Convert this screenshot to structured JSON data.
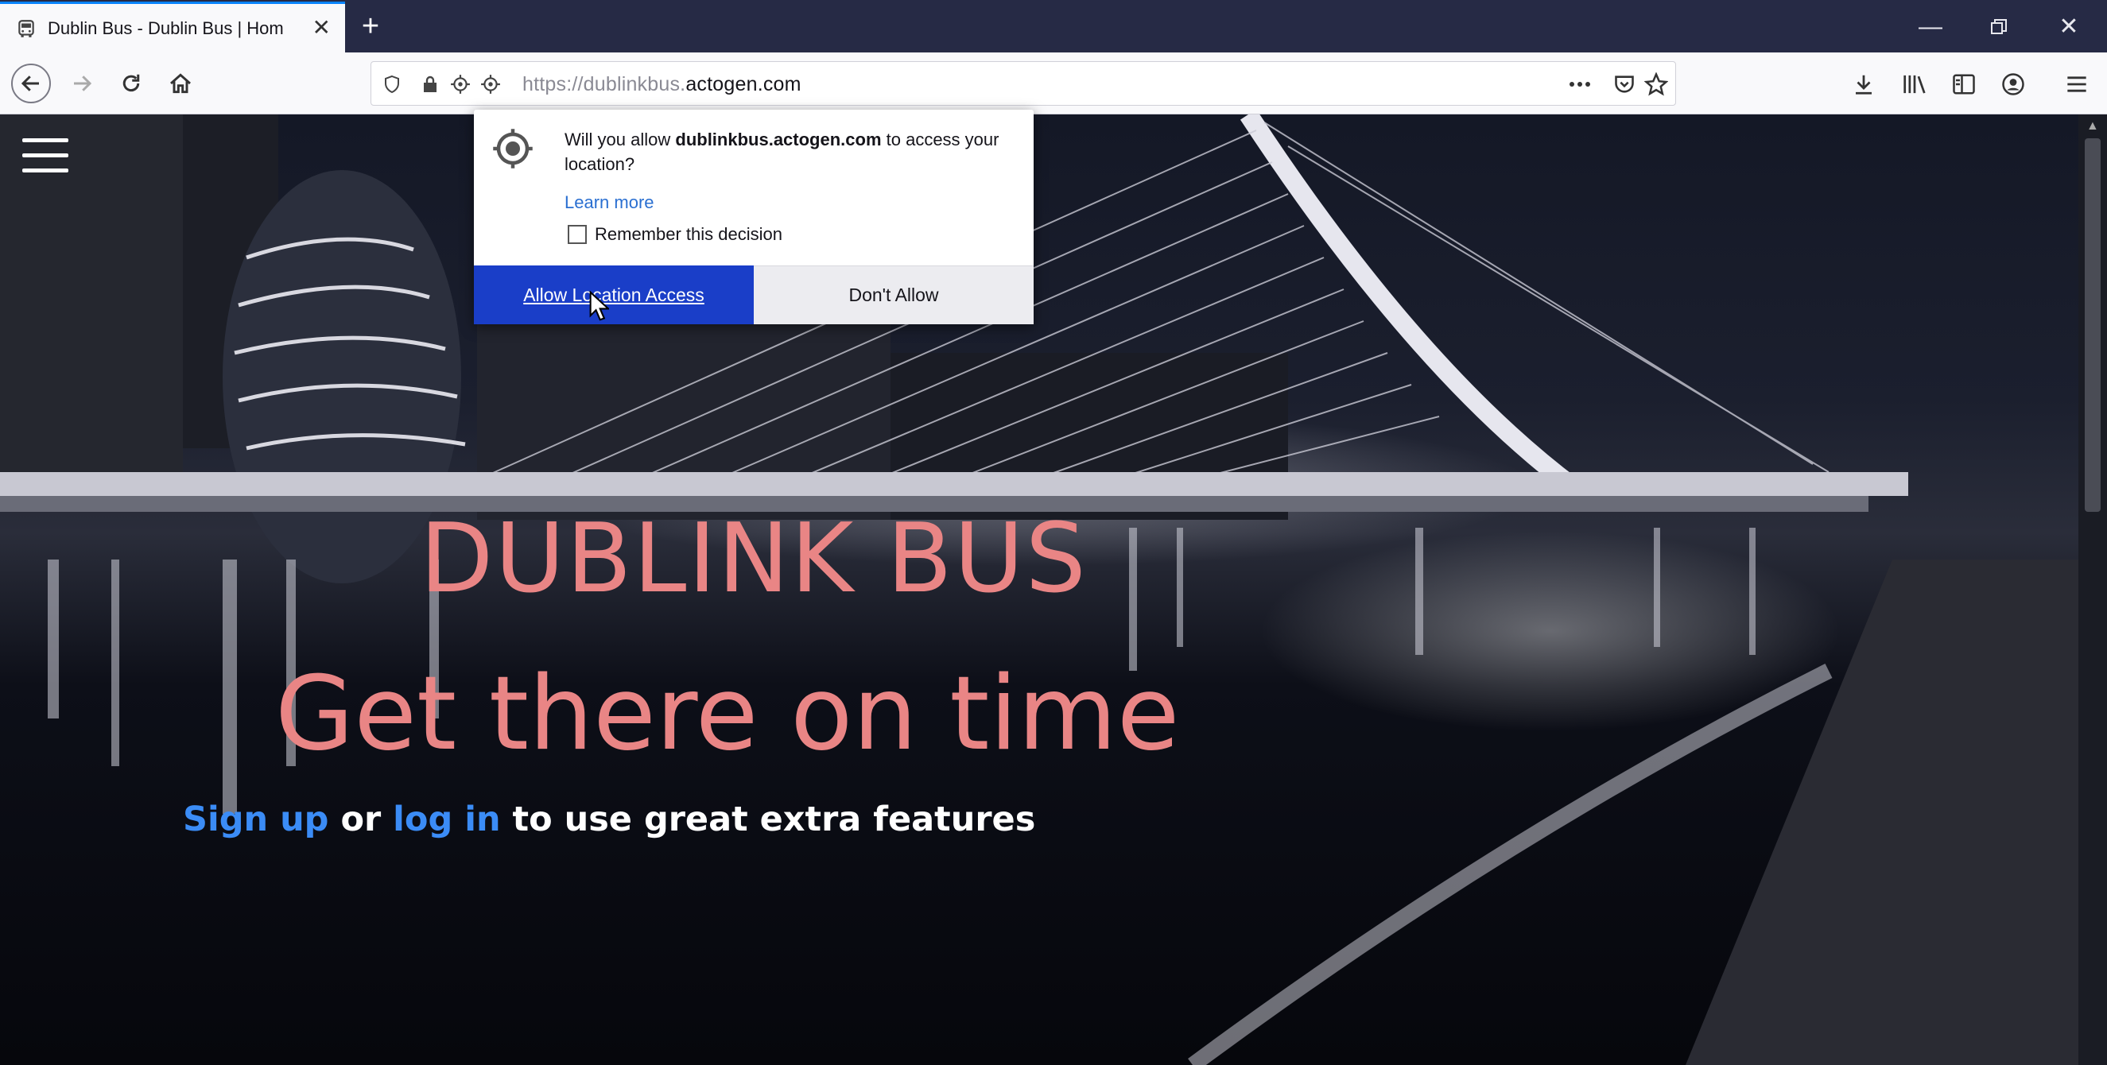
{
  "browser": {
    "tab_title": "Dublin Bus - Dublin Bus | Hom",
    "url_prefix": "https://dublinkbus.",
    "url_domain": "actogen.com"
  },
  "permission_popup": {
    "msg_before": "Will you allow ",
    "msg_domain": "dublinkbus.actogen.com",
    "msg_after": " to access your location?",
    "learn_more": "Learn more",
    "remember_label": "Remember this decision",
    "allow_label": "Allow Location Access",
    "deny_label": "Don't Allow"
  },
  "hero": {
    "title": "DUBLINK BUS",
    "subtitle": "Get there on time",
    "cta_signup": "Sign up",
    "cta_or": " or ",
    "cta_login": "log in",
    "cta_rest": " to use great extra features"
  },
  "colors": {
    "accent": "#e98585",
    "link": "#3b8cf6",
    "allow_button": "#1a3ec8"
  }
}
